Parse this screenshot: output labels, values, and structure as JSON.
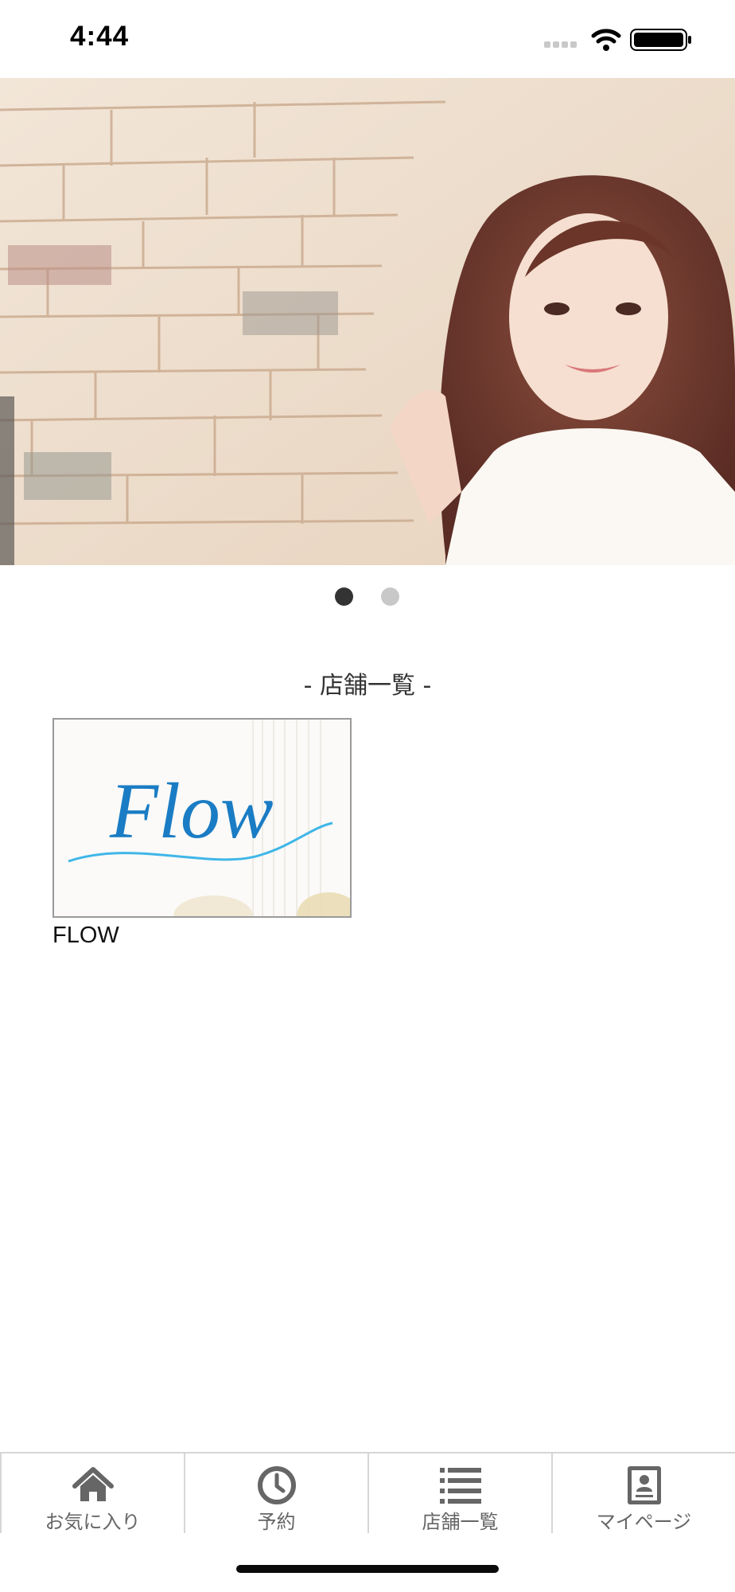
{
  "status_bar": {
    "time": "4:44"
  },
  "hero": {
    "dots_total": 2,
    "active_index": 0
  },
  "section": {
    "heading": "- 店舗一覧 -"
  },
  "stores": [
    {
      "logo_text": "Flow",
      "name": "FLOW"
    }
  ],
  "tab_bar": {
    "tabs": [
      {
        "label": "お気に入り",
        "icon": "home-icon"
      },
      {
        "label": "予約",
        "icon": "clock-icon"
      },
      {
        "label": "店舗一覧",
        "icon": "list-icon"
      },
      {
        "label": "マイページ",
        "icon": "profile-card-icon"
      }
    ]
  },
  "colors": {
    "logo_blue": "#1a7cc4",
    "wave_blue": "#3fb6e8",
    "active_dot": "#333333",
    "inactive_dot": "#c8c8c8",
    "tab_icon": "#666666"
  }
}
